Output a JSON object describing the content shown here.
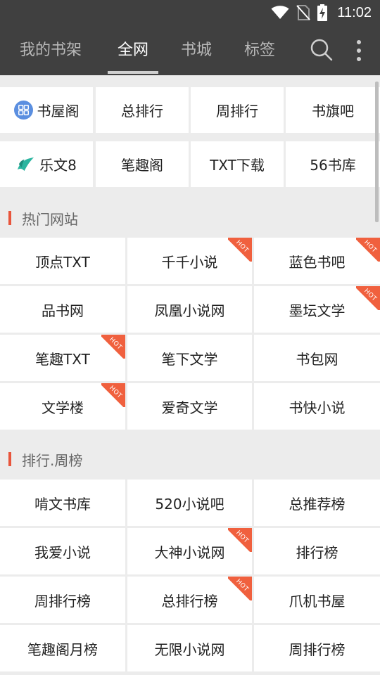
{
  "status": {
    "time": "11:02"
  },
  "nav": {
    "tabs": [
      "我的书架",
      "全网",
      "书城",
      "标签"
    ],
    "active_tab": "全网"
  },
  "quick_sites": [
    {
      "label": "书屋阁",
      "icon": "grid-app-icon"
    },
    {
      "label": "总排行"
    },
    {
      "label": "周排行"
    },
    {
      "label": "书旗吧"
    },
    {
      "label": "乐文8",
      "icon": "leaf-logo-icon"
    },
    {
      "label": "笔趣阁"
    },
    {
      "label": "TXT下载"
    },
    {
      "label": "56书库"
    }
  ],
  "sections": [
    {
      "title": "热门网站",
      "items": [
        {
          "label": "顶点TXT",
          "hot": false
        },
        {
          "label": "千千小说",
          "hot": true
        },
        {
          "label": "蓝色书吧",
          "hot": true
        },
        {
          "label": "品书网",
          "hot": false
        },
        {
          "label": "凤凰小说网",
          "hot": false
        },
        {
          "label": "墨坛文学",
          "hot": true
        },
        {
          "label": "笔趣TXT",
          "hot": true
        },
        {
          "label": "笔下文学",
          "hot": false
        },
        {
          "label": "书包网",
          "hot": false
        },
        {
          "label": "文学楼",
          "hot": true
        },
        {
          "label": "爱奇文学",
          "hot": false
        },
        {
          "label": "书快小说",
          "hot": false
        }
      ]
    },
    {
      "title": "排行.周榜",
      "items": [
        {
          "label": "啃文书库",
          "hot": false
        },
        {
          "label": "520小说吧",
          "hot": false
        },
        {
          "label": "总推荐榜",
          "hot": false
        },
        {
          "label": "我爱小说",
          "hot": false
        },
        {
          "label": "大神小说网",
          "hot": true
        },
        {
          "label": "排行榜",
          "hot": false
        },
        {
          "label": "周排行榜",
          "hot": false
        },
        {
          "label": "总排行榜",
          "hot": true
        },
        {
          "label": "爪机书屋",
          "hot": false
        },
        {
          "label": "笔趣阁月榜",
          "hot": false
        },
        {
          "label": "无限小说网",
          "hot": false
        },
        {
          "label": "周排行榜",
          "hot": false
        }
      ]
    }
  ],
  "hot_badge_text": "HOT",
  "colors": {
    "app_bar": "#404040",
    "accent": "#e8553c",
    "hot_badge": "#f0603e",
    "page_bg": "#ececec"
  }
}
